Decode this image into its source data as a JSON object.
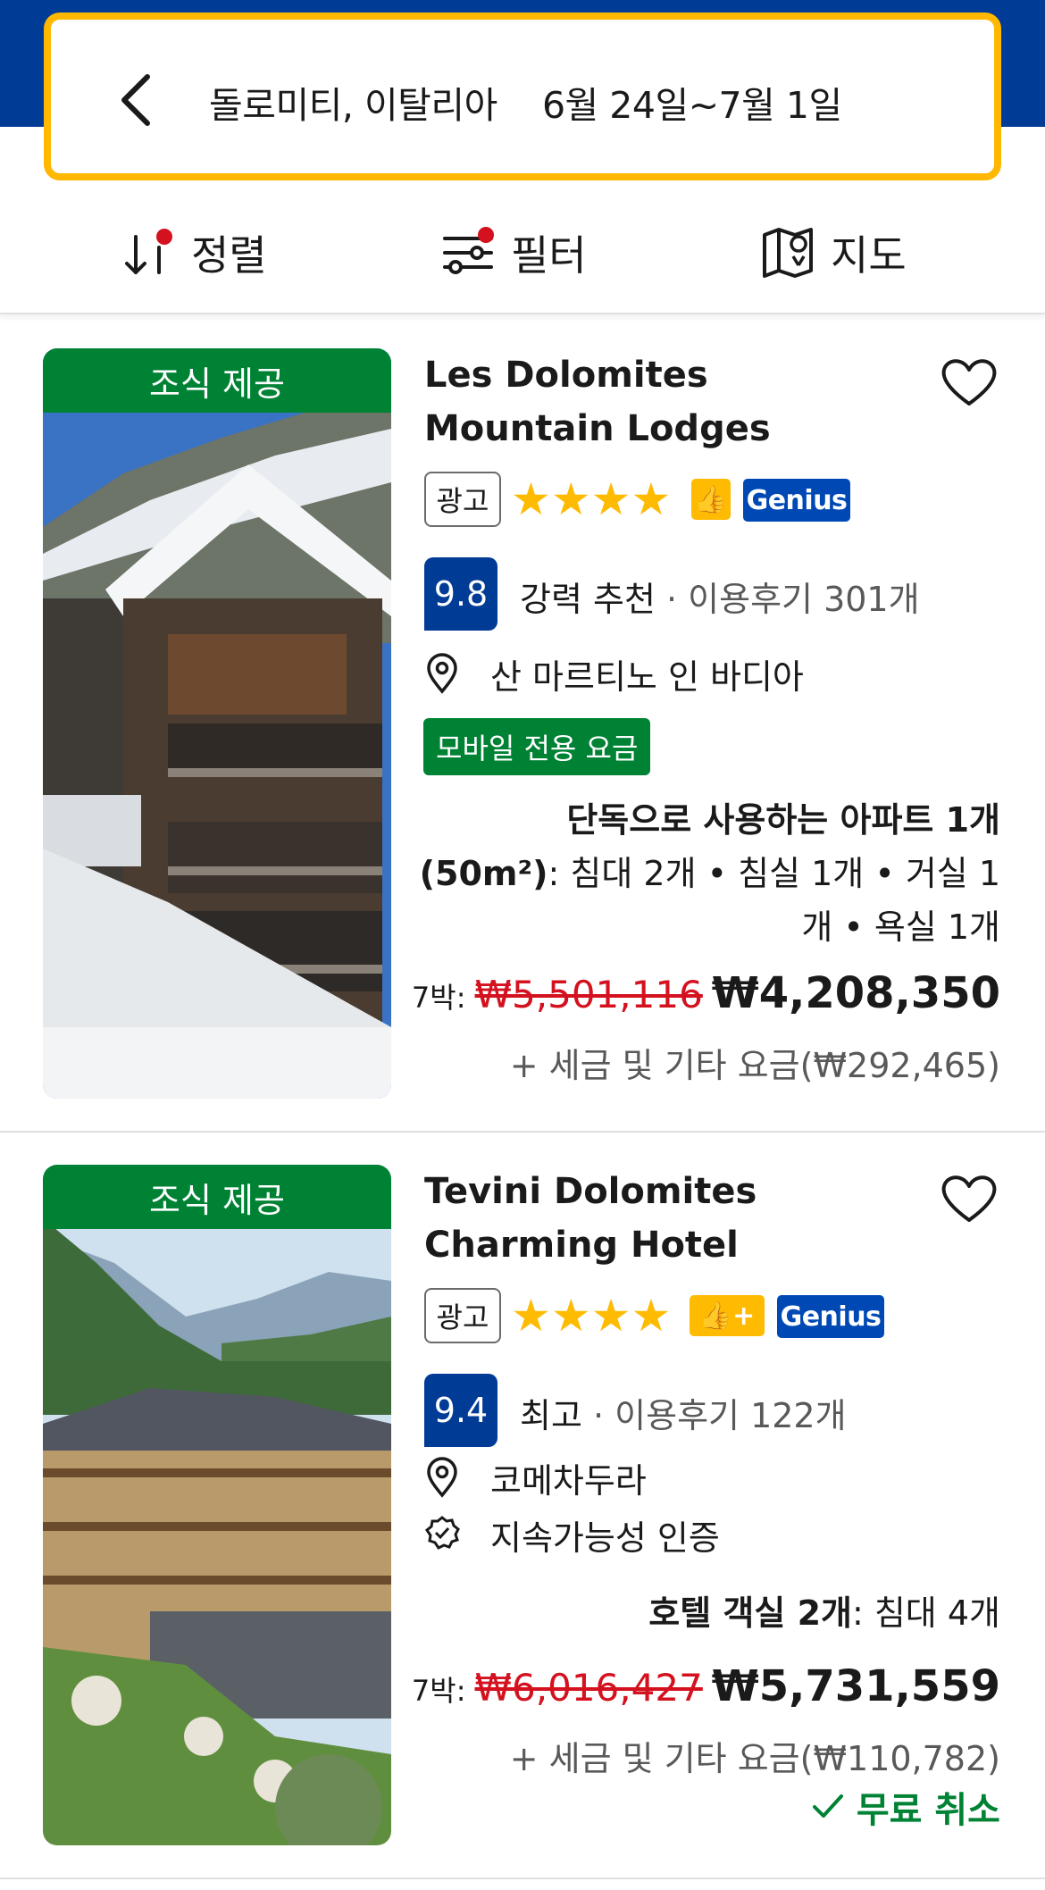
{
  "header": {
    "destination": "돌로미티, 이탈리아",
    "dates": "6월 24일~7월 1일"
  },
  "toolbar": {
    "sort_label": "정렬",
    "filter_label": "필터",
    "map_label": "지도"
  },
  "colors": {
    "brand_blue": "#003b95",
    "search_border": "#ffb700",
    "green": "#008234",
    "star": "#febb02",
    "price_red": "#d4111e"
  },
  "listings": [
    {
      "photo_badge": "조식 제공",
      "name_line1": "Les Dolomites",
      "name_line2": "Mountain Lodges",
      "ad_label": "광고",
      "stars": 4,
      "genius_label": "Genius",
      "score": "9.8",
      "score_label": "강력 추천",
      "reviews": " · 이용후기 301개",
      "location": "산 마르티노 인 바디아",
      "mobile_badge": "모바일 전용 요금",
      "room_bold": "단독으로 사용하는 아파트 1개",
      "room_line2_bold": "(50m²)",
      "room_line2_rest": ": 침대 2개 • 침실 1개 • 거실 1",
      "room_line3": "개 • 욕실 1개",
      "nights": "7박:",
      "old_price": "₩5,501,116",
      "new_price": "₩4,208,350",
      "tax": "+ 세금 및 기타 요금(₩292,465)"
    },
    {
      "photo_badge": "조식 제공",
      "name_line1": "Tevini Dolomites",
      "name_line2": "Charming Hotel",
      "ad_label": "광고",
      "stars": 4,
      "genius_label": "Genius",
      "score": "9.4",
      "score_label": "최고",
      "reviews": " · 이용후기 122개",
      "location": "코메차두라",
      "sustainability": "지속가능성 인증",
      "room_bold": "호텔 객실 2개",
      "room_rest": ": 침대 4개",
      "nights": "7박:",
      "old_price": "₩6,016,427",
      "new_price": "₩5,731,559",
      "tax": "+ 세금 및 기타 요금(₩110,782)",
      "free_cancel": "무료 취소"
    }
  ]
}
